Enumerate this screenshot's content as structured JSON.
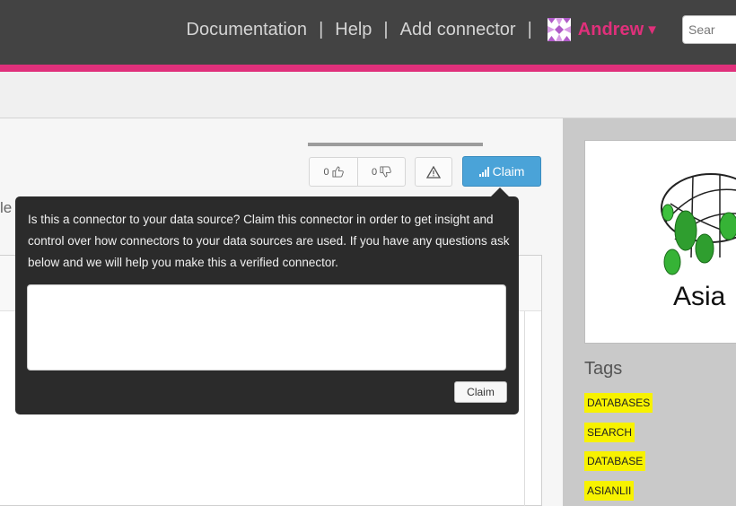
{
  "nav": {
    "links": [
      "Documentation",
      "Help",
      "Add connector"
    ],
    "separator": "|",
    "user_name": "Andrew",
    "user_caret": "▼",
    "search_value": "Sear"
  },
  "actions": {
    "upvotes": "0",
    "downvotes": "0",
    "claim_label": "Claim"
  },
  "stray_text": "le",
  "claim_popover": {
    "message": "Is this a connector to your data source? Claim this connector in order to get insight and control over how connectors to your data sources are used. If you have any questions ask below and we will help you make this a verified connector.",
    "textarea_value": "",
    "submit_label": "Claim"
  },
  "sidebar": {
    "logo_text": "Asia",
    "tags_heading": "Tags",
    "tags": [
      "DATABASES",
      "SEARCH",
      "DATABASE",
      "ASIANLII"
    ]
  },
  "colors": {
    "accent_pink": "#e0307b",
    "claim_blue": "#4aa3d8",
    "tag_yellow": "#f7f200",
    "topbar": "#434343"
  }
}
